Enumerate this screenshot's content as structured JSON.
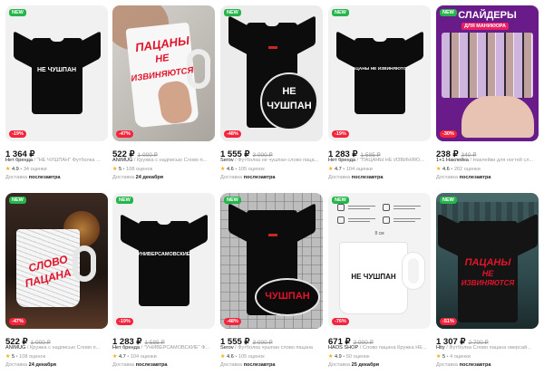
{
  "labels": {
    "new": "NEW"
  },
  "products": [
    {
      "discount": "-19%",
      "price": "1 364 ₽",
      "old_price": "",
      "brand": "Нет бренда",
      "title": "\"НЕ ЧУШПАН\" Футболка ...",
      "rating": "4.9",
      "reviews": "34 оценки",
      "delivery_label": "Доставка",
      "delivery_date": "послезавтра",
      "print_text": "НЕ ЧУШПАН",
      "new": true
    },
    {
      "discount": "-47%",
      "price": "522 ₽",
      "old_price": "1 000 ₽",
      "brand": "ANIMUG",
      "title": "Кружка с надписью Слово п...",
      "rating": "5",
      "reviews": "108 оценок",
      "delivery_label": "Доставка",
      "delivery_date": "24 декабря",
      "print_text_1": "ПАЦАНЫ",
      "print_text_2": "НЕ",
      "print_text_3": "ИЗВИНЯЮТСЯ",
      "new": false
    },
    {
      "discount": "-48%",
      "price": "1 555 ₽",
      "old_price": "3 000 ₽",
      "brand": "Serov",
      "title": "Футболка не чушпан слово паца...",
      "rating": "4.6",
      "reviews": "105 оценок",
      "delivery_label": "Доставка",
      "delivery_date": "послезавтра",
      "print_text_1": "НЕ",
      "print_text_2": "ЧУШПАН",
      "new": true
    },
    {
      "discount": "-19%",
      "price": "1 283 ₽",
      "old_price": "1 585 ₽",
      "brand": "Нет бренда",
      "title": "\"ПАЦАНЫ НЕ ИЗВИНЯЮ...",
      "rating": "4.7",
      "reviews": "104 оценки",
      "delivery_label": "Доставка",
      "delivery_date": "послезавтра",
      "print_text": "ПАЦАНЫ НЕ ИЗВИНЯЮТСЯ",
      "new": true
    },
    {
      "discount": "-30%",
      "price": "238 ₽",
      "old_price": "340 ₽",
      "brand": "1+1 Наклейка",
      "title": "Наклейки для ногтей сл...",
      "rating": "4.6",
      "reviews": "202 оценки",
      "delivery_label": "Доставка",
      "delivery_date": "послезавтра",
      "poster_1": "СЛАЙДЕРЫ",
      "poster_2": "ДЛЯ МАНИКЮРА",
      "new": true
    },
    {
      "discount": "-47%",
      "price": "522 ₽",
      "old_price": "1 000 ₽",
      "brand": "ANIMUG",
      "title": "Кружка с надписью Слово п...",
      "rating": "5",
      "reviews": "108 оценок",
      "delivery_label": "Доставка",
      "delivery_date": "24 декабря",
      "print_text_1": "СЛОВО",
      "print_text_2": "ПАЦАНА",
      "new": true
    },
    {
      "discount": "-19%",
      "price": "1 283 ₽",
      "old_price": "1 585 ₽",
      "brand": "Нет бренда",
      "title": "\"УНИВЕРСАМОВСКИЕ\" Ф...",
      "rating": "4.7",
      "reviews": "104 оценки",
      "delivery_label": "Доставка",
      "delivery_date": "послезавтра",
      "print_text": "УНИВЕРСАМОВСКИЕ",
      "new": true
    },
    {
      "discount": "-48%",
      "price": "1 555 ₽",
      "old_price": "3 000 ₽",
      "brand": "Serov",
      "title": "Футболка чушпан слово пацана",
      "rating": "4.6",
      "reviews": "105 оценок",
      "delivery_label": "Доставка",
      "delivery_date": "послезавтра",
      "print_text": "ЧУШПАН",
      "new": true
    },
    {
      "discount": "-76%",
      "price": "671 ₽",
      "old_price": "2 900 ₽",
      "brand": "HAOS SHOP",
      "title": "Слово пацана Кружка НЕ...",
      "rating": "4.9",
      "reviews": "50 оценок",
      "delivery_label": "Доставка",
      "delivery_date": "25 декабря",
      "print_text": "НЕ ЧУШПАН",
      "size_label": "8 см",
      "new": true
    },
    {
      "discount": "-51%",
      "price": "1 307 ₽",
      "old_price": "2 700 ₽",
      "brand": "Hity",
      "title": "Футболка Слово пацана оверсай...",
      "rating": "5",
      "reviews": "4 оценки",
      "delivery_label": "Доставка",
      "delivery_date": "послезавтра",
      "print_text_1": "ПАЦАНЫ",
      "print_text_2": "НЕ",
      "print_text_3": "ИЗВИНЯЮТСЯ",
      "new": true
    }
  ]
}
